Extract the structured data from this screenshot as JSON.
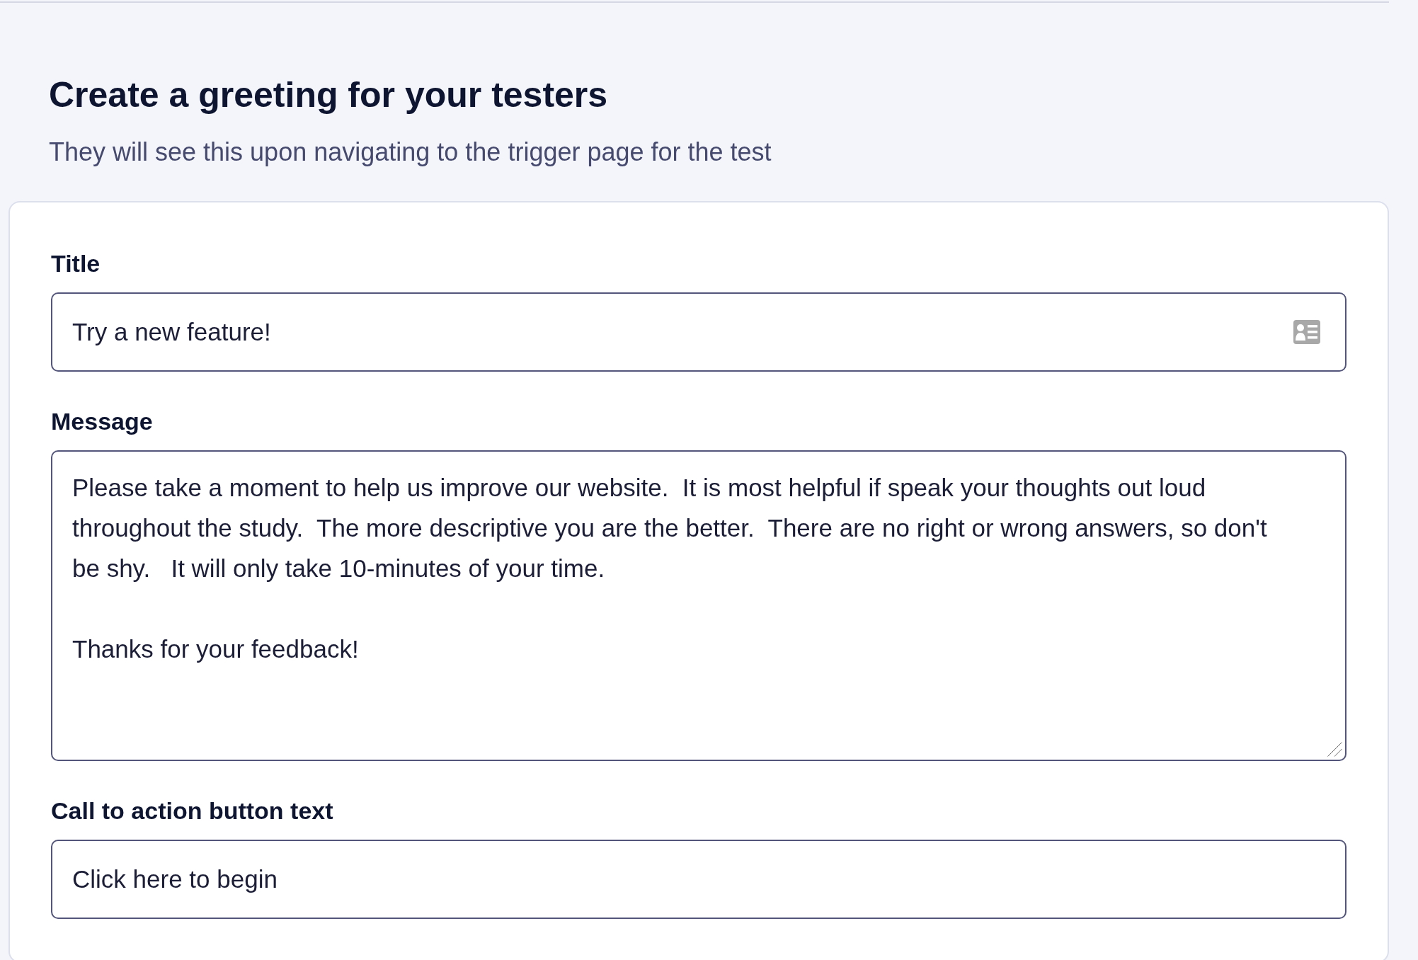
{
  "header": {
    "title": "Create a greeting for your testers",
    "subtitle": "They will see this upon navigating to the trigger page for the test"
  },
  "form": {
    "fields": [
      {
        "kind": "iconinput",
        "label": "Title",
        "value": "Try a new feature!"
      },
      {
        "kind": "textarea",
        "label": "Message",
        "value": "Please take a moment to help us improve our website.  It is most helpful if speak your thoughts out loud throughout the study.  The more descriptive you are the better.  There are no right or wrong answers, so don't be shy.   It will only take 10-minutes of your time.\n\nThanks for your feedback!"
      },
      {
        "kind": "input",
        "label": "Call to action button text",
        "value": "Click here to begin"
      }
    ]
  }
}
